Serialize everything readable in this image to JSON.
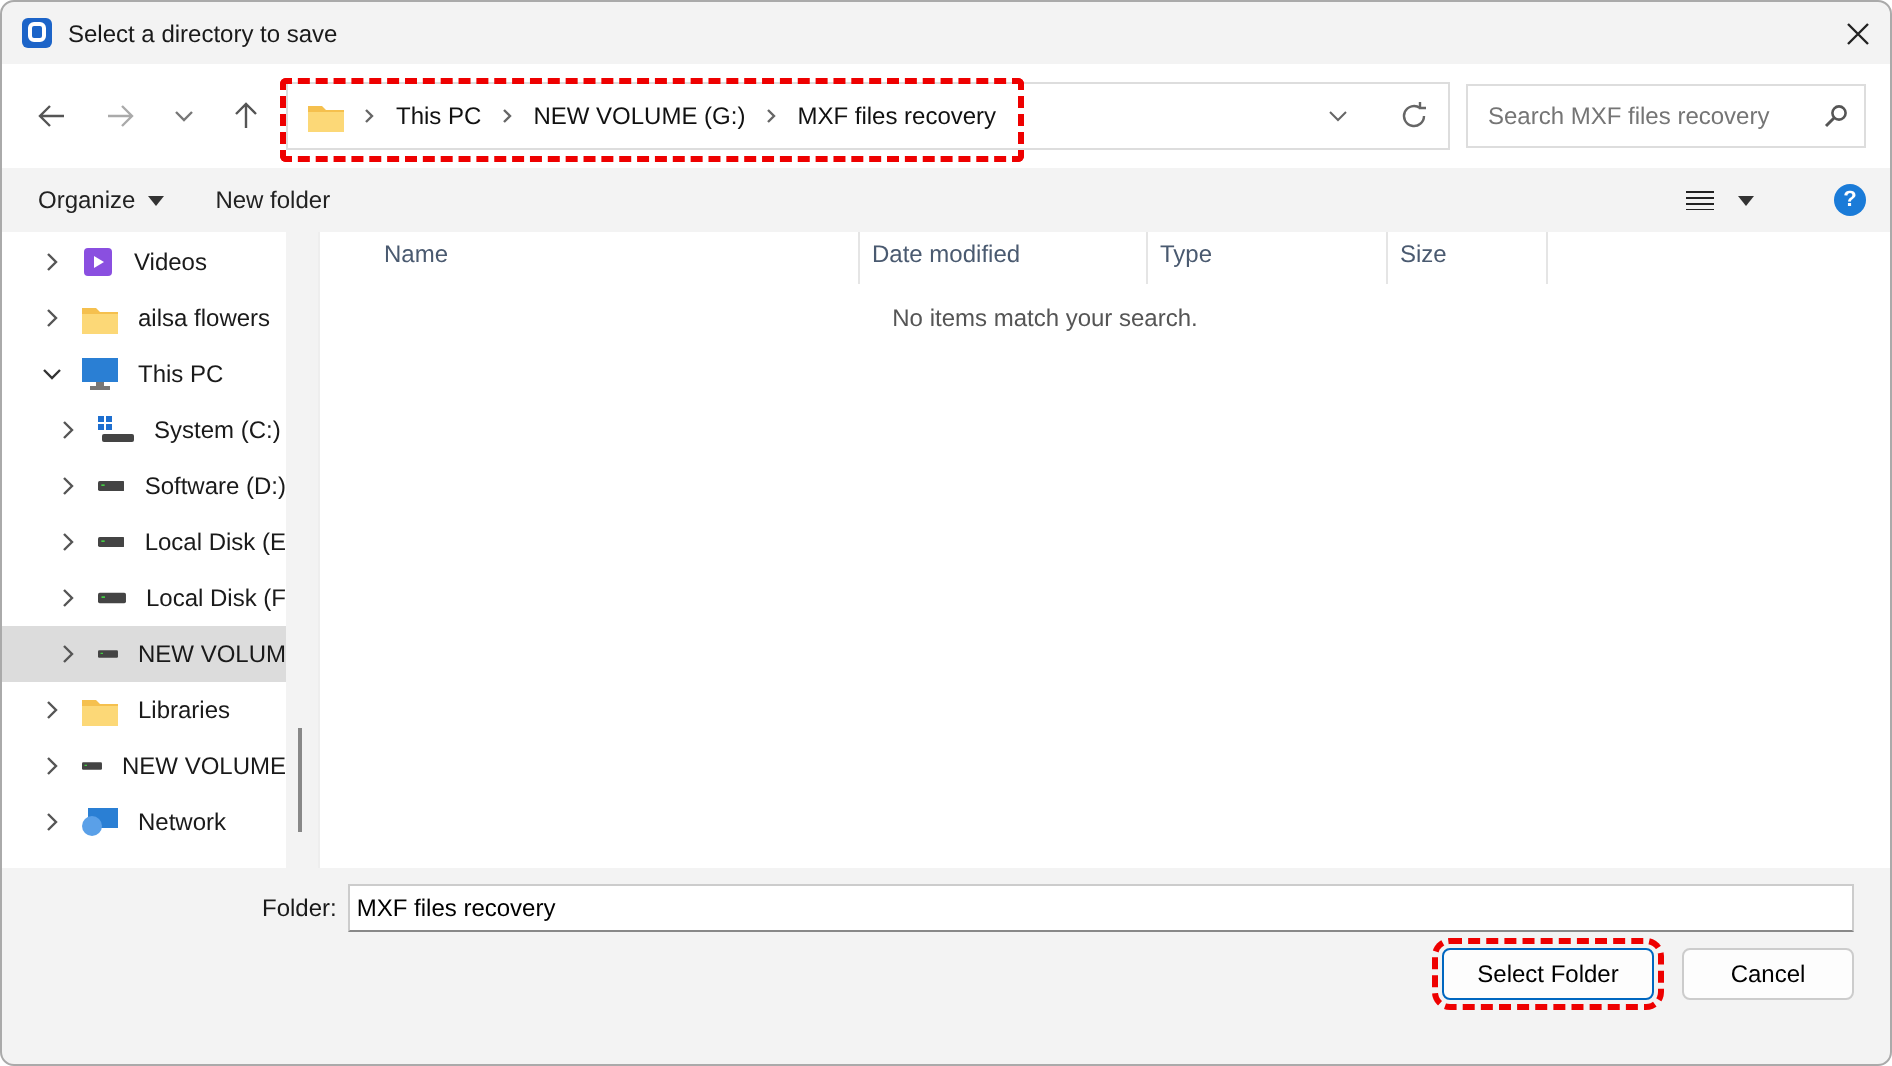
{
  "window": {
    "title": "Select a directory to save"
  },
  "address_bar": {
    "highlighted": true,
    "crumbs": [
      "This PC",
      "NEW VOLUME (G:)",
      "MXF files recovery"
    ]
  },
  "search": {
    "placeholder": "Search MXF files recovery"
  },
  "toolbar": {
    "organize": "Organize",
    "new_folder": "New folder",
    "help": "?"
  },
  "tree": [
    {
      "label": "Videos",
      "kind": "videos",
      "expanded": false,
      "selected": false
    },
    {
      "label": "ailsa flowers",
      "kind": "folder",
      "expanded": false,
      "selected": false
    },
    {
      "label": "This PC",
      "kind": "pc",
      "expanded": true,
      "selected": false,
      "children": [
        {
          "label": "System (C:)",
          "kind": "system",
          "expanded": false,
          "selected": false
        },
        {
          "label": "Software (D:)",
          "kind": "drive",
          "expanded": false,
          "selected": false
        },
        {
          "label": "Local Disk (E",
          "kind": "drive",
          "expanded": false,
          "selected": false
        },
        {
          "label": "Local Disk (F",
          "kind": "drive",
          "expanded": false,
          "selected": false
        },
        {
          "label": "NEW VOLUM",
          "kind": "drive",
          "expanded": false,
          "selected": true
        }
      ]
    },
    {
      "label": "Libraries",
      "kind": "folder",
      "expanded": false,
      "selected": false
    },
    {
      "label": "NEW VOLUME",
      "kind": "drive",
      "expanded": false,
      "selected": false
    },
    {
      "label": "Network",
      "kind": "network",
      "expanded": false,
      "selected": false
    }
  ],
  "table": {
    "columns": [
      "Name",
      "Date modified",
      "Type",
      "Size"
    ],
    "empty_message": "No items match your search."
  },
  "folder_field": {
    "label": "Folder:",
    "value": "MXF files recovery"
  },
  "buttons": [
    {
      "label": "Select Folder",
      "highlighted": true
    },
    {
      "label": "Cancel",
      "highlighted": false
    }
  ]
}
